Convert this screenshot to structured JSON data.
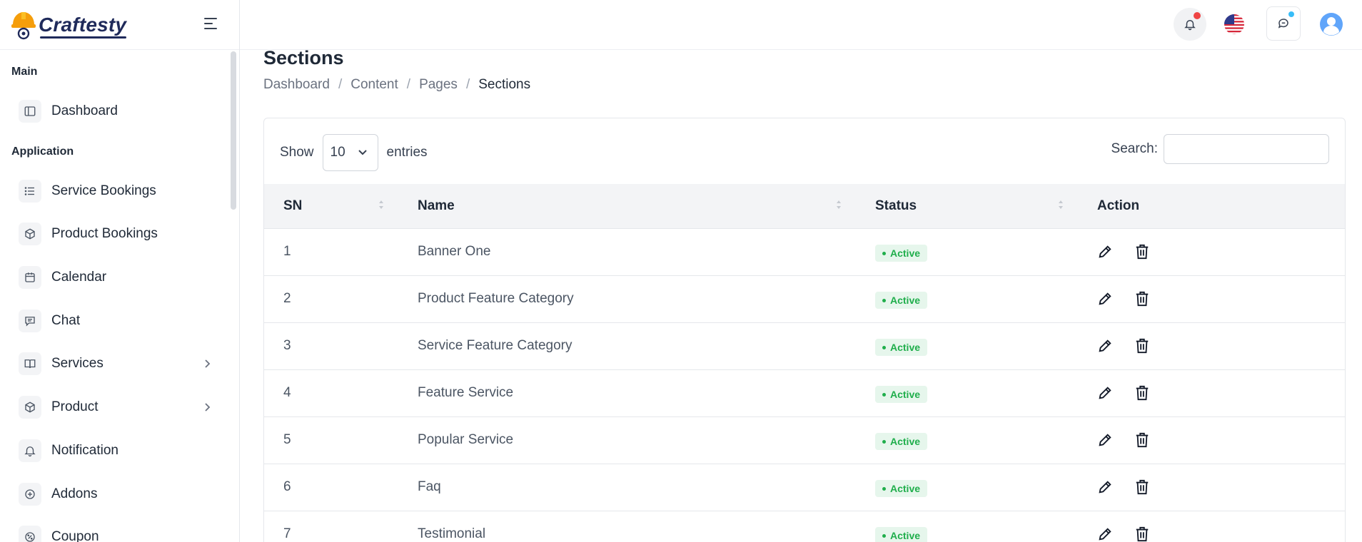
{
  "brand": {
    "name": "Craftesty"
  },
  "sidebar": {
    "sections": [
      {
        "label": "Main"
      },
      {
        "label": "Application"
      }
    ],
    "items": [
      {
        "label": "Dashboard",
        "icon": "layout-sidebar-icon"
      },
      {
        "label": "Service Bookings",
        "icon": "list-icon"
      },
      {
        "label": "Product Bookings",
        "icon": "box-icon"
      },
      {
        "label": "Calendar",
        "icon": "calendar-icon"
      },
      {
        "label": "Chat",
        "icon": "message-square-icon"
      },
      {
        "label": "Services",
        "icon": "book-open-icon",
        "has_submenu": true
      },
      {
        "label": "Product",
        "icon": "box-icon",
        "has_submenu": true
      },
      {
        "label": "Notification",
        "icon": "bell-icon"
      },
      {
        "label": "Addons",
        "icon": "plus-circle-icon"
      },
      {
        "label": "Coupon",
        "icon": "percent-icon"
      }
    ]
  },
  "header": {
    "icons": [
      "bell-icon",
      "us-flag-icon",
      "chat-icon",
      "user-avatar-icon"
    ],
    "colors": {
      "bell_dot": "#ef4444",
      "chat_dot": "#38bdf8"
    }
  },
  "page": {
    "title": "Sections",
    "breadcrumb": [
      "Dashboard",
      "Content",
      "Pages",
      "Sections"
    ]
  },
  "table_controls": {
    "show_label": "Show",
    "page_length": "10",
    "entries_label": "entries",
    "search_label": "Search:",
    "search_value": ""
  },
  "table": {
    "columns": [
      "SN",
      "Name",
      "Status",
      "Action"
    ],
    "rows": [
      {
        "sn": "1",
        "name": "Banner One",
        "status": "Active"
      },
      {
        "sn": "2",
        "name": "Product Feature Category",
        "status": "Active"
      },
      {
        "sn": "3",
        "name": "Service Feature Category",
        "status": "Active"
      },
      {
        "sn": "4",
        "name": "Feature Service",
        "status": "Active"
      },
      {
        "sn": "5",
        "name": "Popular Service",
        "status": "Active"
      },
      {
        "sn": "6",
        "name": "Faq",
        "status": "Active"
      },
      {
        "sn": "7",
        "name": "Testimonial",
        "status": "Active"
      }
    ]
  },
  "colors": {
    "status_active_text": "#1fae4b",
    "status_active_bg": "#e6f6ec",
    "brand": "#1f2a5a",
    "brand_accent": "#f59e0b"
  }
}
